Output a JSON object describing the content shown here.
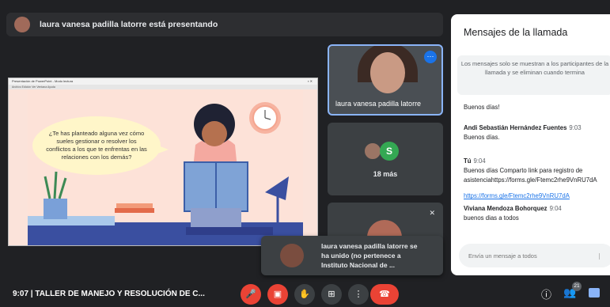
{
  "presenter": {
    "text": "laura vanesa padilla latorre está presentando"
  },
  "slide": {
    "window_title": "Presentación de PowerPoint - Modo lectura",
    "window_menu": "Archivo  Edición  Ver  Ventana  Ayuda",
    "bubble_text": "¿Te has planteado alguna vez cómo sueles gestionar o resolver los conflictos a los que te enfrentas en las relaciones con los demás?"
  },
  "tiles": {
    "main_name": "laura vanesa padilla latorre",
    "more_initial": "S",
    "more_count": "18 más"
  },
  "toast": {
    "text": "laura vanesa padilla latorre se ha unido (no pertenece a Instituto Nacional de ..."
  },
  "chat": {
    "title": "Mensajes de la llamada",
    "info": "Los mensajes solo se muestran a los participantes de la llamada y se eliminan cuando termina",
    "messages": [
      {
        "sender": "",
        "time": "",
        "text": "Buenos días!"
      },
      {
        "sender": "Andi Sebastián Hernández Fuentes",
        "time": "9:03",
        "text": "Buenos días."
      },
      {
        "sender": "Tú",
        "time": "9:04",
        "text": "Buenos días Comparto link para registro de asistenciahttps://forms.gle/Ftemc2rhe9VnRU7dA"
      },
      {
        "sender": "",
        "time": "",
        "text": "https://forms.gle/Ftemc2rhe9VnRU7dA"
      },
      {
        "sender": "Viviana Mendoza Bohorquez",
        "time": "9:04",
        "text": "buenos dias a todos"
      }
    ],
    "input_placeholder": "Envía un mensaje a todos"
  },
  "bottombar": {
    "time": "9:07",
    "meeting_title": "TALLER DE MANEJO Y RESOLUCIÓN DE C...",
    "participants_badge": "21"
  },
  "colors": {
    "accent": "#1a73e8",
    "end_call": "#ea4335",
    "background": "#202124"
  },
  "icons": [
    "presenter-avatar",
    "more-options-icon",
    "mic-off-icon",
    "camera-off-icon",
    "hand-icon",
    "present-icon",
    "more-vert-icon",
    "end-call-icon",
    "info-icon",
    "people-icon",
    "chat-icon",
    "send-icon"
  ]
}
